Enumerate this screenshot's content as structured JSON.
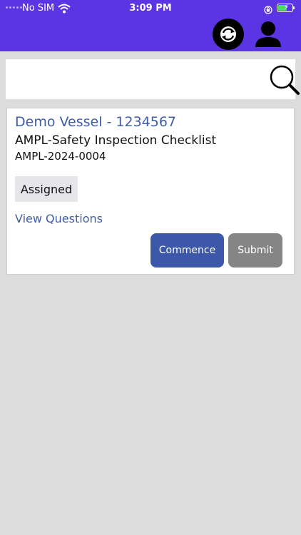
{
  "status_bar": {
    "carrier": "No SIM",
    "time": "3:09 PM"
  },
  "header": {
    "sync_icon": "sync-icon",
    "profile_icon": "user-icon"
  },
  "search": {
    "value": "",
    "placeholder": "",
    "icon": "search-icon"
  },
  "card": {
    "vessel": "Demo Vessel - 1234567",
    "checklist": "AMPL-Safety Inspection Checklist",
    "reference": "AMPL-2024-0004",
    "status": "Assigned",
    "view_link": "View Questions",
    "commence_label": "Commence",
    "submit_label": "Submit"
  },
  "colors": {
    "header_bg": "#5b35e3",
    "link": "#3f5da6",
    "commence_bg": "#3d58a8",
    "submit_bg": "#858585",
    "page_bg": "#dcdcdc"
  }
}
